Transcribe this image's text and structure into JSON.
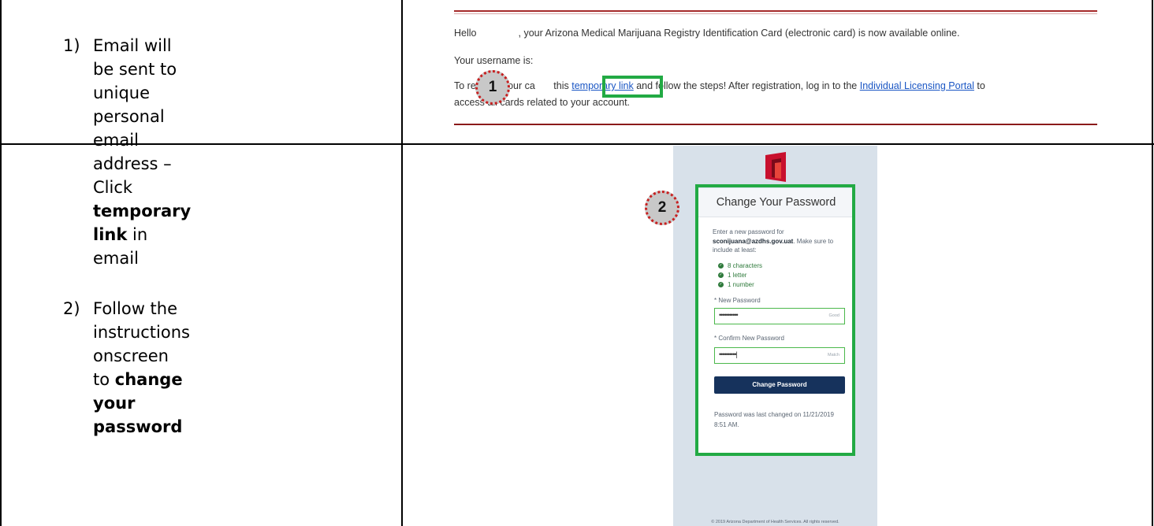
{
  "steps": [
    {
      "number": "1)",
      "line1": "Email will be sent to unique",
      "line2": "personal email address –",
      "line3_pre": "Click ",
      "line3_bold": "temporary link",
      "line3_post": " in email"
    },
    {
      "number": "2)",
      "line1": "Follow the instructions",
      "line2_pre": "onscreen to ",
      "line2_bold": "change your",
      "line3_bold": "password"
    }
  ],
  "email": {
    "greeting_hello": "Hello",
    "greeting_rest": ", your Arizona Medical Marijuana Registry Identification Card (electronic card) is now available online.",
    "username_label": "Your username is:",
    "retrieve_pre": "To retrieve your ca",
    "retrieve_mid": " this ",
    "temporary_link": "temporary link",
    "retrieve_post": " and follow the steps! After registration, log in to the ",
    "portal_link": "Individual Licensing Portal",
    "retrieve_end": " to",
    "line4": "access all cards related to your account."
  },
  "markers": {
    "one": "1",
    "two": "2"
  },
  "password_form": {
    "title": "Change Your Password",
    "intro_1": "Enter a new password for",
    "username": "sconijuana@azdhs.gov.uat",
    "intro_2": ". Make sure to",
    "intro_3": "include at least:",
    "requirements": [
      "8 characters",
      "1 letter",
      "1 number"
    ],
    "new_password_label": "* New Password",
    "new_password_value": "•••••••••••",
    "new_password_hint": "Good",
    "confirm_label": "* Confirm New Password",
    "confirm_value": "••••••••••|",
    "confirm_hint": "Match",
    "button": "Change Password",
    "last_changed_1": "Password was last changed on 11/21/2019",
    "last_changed_2": "8:51 AM.",
    "footer": "© 2019 Arizona Department of Health Services. All rights reserved."
  },
  "colors": {
    "highlight": "#22aa44",
    "marker_border": "#c62020",
    "button": "#16325c",
    "link": "#1a56c4"
  }
}
